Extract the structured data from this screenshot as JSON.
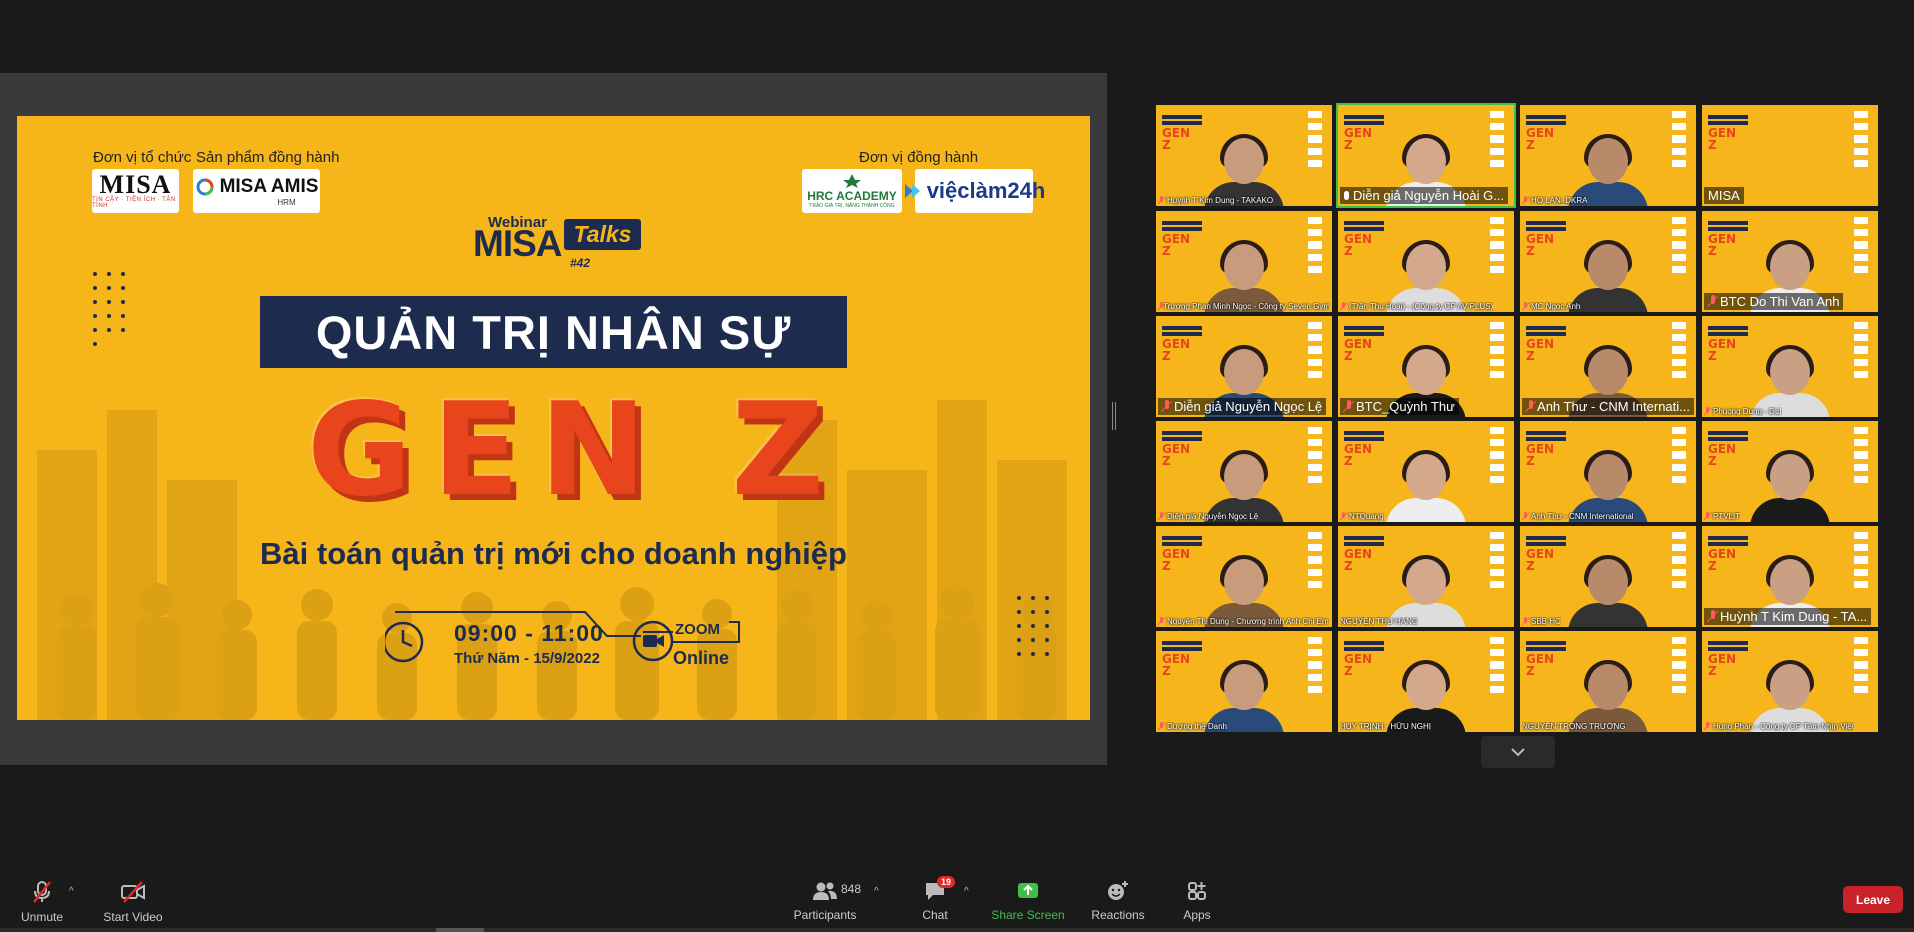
{
  "slide": {
    "organizer_label": "Đơn vị tổ chức",
    "product_label": "Sản phẩm đồng hành",
    "partner_label": "Đơn vị đồng hành",
    "logo_misa": "MISA",
    "logo_misa_tagline": "TIN CẬY · TIỆN ÍCH · TẬN TÌNH",
    "logo_amis": "MISA AMIS",
    "logo_amis_sub": "HRM",
    "logo_hrc": "HRC ACADEMY",
    "logo_hrc_sub": "TRAO GIÁ TRỊ, NÂNG THÀNH CÔNG",
    "logo_vieclam": "việclàm24h",
    "webinar": "Webinar",
    "misa": "MISA",
    "talks": "Talks",
    "episode": "#42",
    "title": "QUẢN TRỊ NHÂN SỰ",
    "headline": "GEN Z",
    "subtitle": "Bài toán quản trị mới cho doanh nghiệp",
    "time": "09:00 - 11:00",
    "date": "Thứ Năm - 15/9/2022",
    "platform": "ZOOM",
    "mode": "Online"
  },
  "tile_bg": {
    "headline": "GEN Z"
  },
  "gallery": {
    "tiles": [
      {
        "name": "Huỳnh T Kim Dung - TAKAKO",
        "muted": true,
        "large": false,
        "speaker": false
      },
      {
        "name": "Diễn giả Nguyễn Hoài G...",
        "muted": false,
        "large": true,
        "speaker": true
      },
      {
        "name": "HO LAN_DKRA",
        "muted": true,
        "large": false,
        "speaker": false
      },
      {
        "name": "MISA",
        "muted": false,
        "large": true,
        "speaker": false
      },
      {
        "name": "Trương Phan Minh Ngọc - Công ty Seven Gym",
        "muted": true,
        "large": false,
        "speaker": false
      },
      {
        "name": "(Trần Thu Hoài) - (Công ty CP AV PLUS)",
        "muted": true,
        "large": false,
        "speaker": false
      },
      {
        "name": "MC Ngọc Anh",
        "muted": true,
        "large": false,
        "speaker": false
      },
      {
        "name": "BTC Do Thi Van Anh",
        "muted": true,
        "large": true,
        "speaker": false
      },
      {
        "name": "Diễn giả Nguyễn Ngọc Lệ",
        "muted": true,
        "large": true,
        "speaker": false
      },
      {
        "name": "BTC_Quỳnh Thư",
        "muted": true,
        "large": true,
        "speaker": false
      },
      {
        "name": "Anh Thư - CNM Internati...",
        "muted": true,
        "large": true,
        "speaker": false
      },
      {
        "name": "Phuong Dung - DLI",
        "muted": true,
        "large": false,
        "speaker": false
      },
      {
        "name": "Diễn giả Nguyễn Ngọc Lệ",
        "muted": true,
        "large": false,
        "speaker": false
      },
      {
        "name": "NTQuang",
        "muted": true,
        "large": false,
        "speaker": false
      },
      {
        "name": "Anh Thư - CNM International",
        "muted": true,
        "large": false,
        "speaker": false
      },
      {
        "name": "PTVLIT",
        "muted": true,
        "large": false,
        "speaker": false
      },
      {
        "name": "Nguyễn Thị Dung - Chương trình Anh Chị Em",
        "muted": true,
        "large": false,
        "speaker": false
      },
      {
        "name": "NGUYỄN THU HẰNG",
        "muted": false,
        "large": false,
        "speaker": false
      },
      {
        "name": "SBB HC",
        "muted": true,
        "large": false,
        "speaker": false
      },
      {
        "name": "Huỳnh T Kim Dung - TA...",
        "muted": true,
        "large": true,
        "speaker": false
      },
      {
        "name": "Dương thế Danh",
        "muted": true,
        "large": false,
        "speaker": false
      },
      {
        "name": "HUY TRỊNH - HỮU NGHỊ",
        "muted": false,
        "large": false,
        "speaker": false
      },
      {
        "name": "NGUYỄN TRỌNG TRƯỜNG",
        "muted": false,
        "large": false,
        "speaker": false
      },
      {
        "name": "Hung Phan - Công ty CP Tầm Nhìn Việt",
        "muted": true,
        "large": false,
        "speaker": false
      }
    ]
  },
  "toolbar": {
    "unmute": "Unmute",
    "start_video": "Start Video",
    "participants": "Participants",
    "participants_count": "848",
    "chat": "Chat",
    "chat_badge": "19",
    "share_screen": "Share Screen",
    "reactions": "Reactions",
    "apps": "Apps",
    "leave": "Leave"
  },
  "colors": {
    "slide_bg": "#f6b61a",
    "navy": "#1d2b4f",
    "genz": "#e8451c",
    "share_green": "#3fbf4a",
    "leave_red": "#c9222a"
  }
}
